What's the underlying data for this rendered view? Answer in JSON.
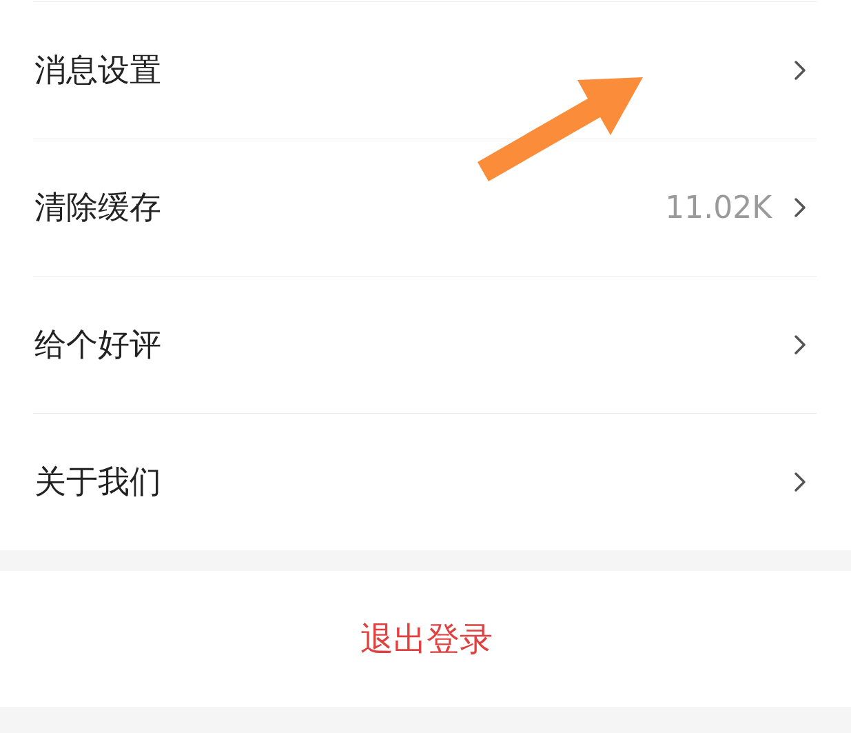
{
  "settings_items": [
    {
      "label": "消息设置"
    },
    {
      "label": "清除缓存",
      "value": "11.02K"
    },
    {
      "label": "给个好评"
    },
    {
      "label": "关于我们"
    }
  ],
  "logout_button": {
    "label": "退出登录"
  }
}
